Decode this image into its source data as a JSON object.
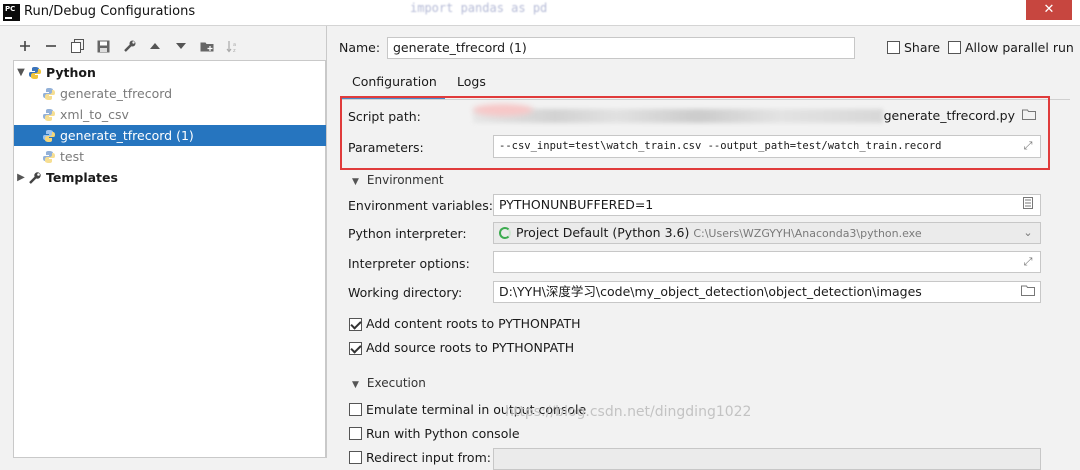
{
  "window": {
    "title": "Run/Debug Configurations",
    "app_icon_text": "PC",
    "background_code": "import pandas as pd",
    "close_glyph": "✕"
  },
  "toolbar": {
    "icons": [
      "add-icon",
      "remove-icon",
      "copy-icon",
      "save-icon",
      "wrench-icon",
      "move-up-icon",
      "move-down-icon",
      "folder-icon",
      "sort-icon"
    ]
  },
  "tree": {
    "python_label": "Python",
    "items": [
      {
        "label": "generate_tfrecord"
      },
      {
        "label": "xml_to_csv"
      },
      {
        "label": "generate_tfrecord (1)"
      },
      {
        "label": "test"
      }
    ],
    "templates_label": "Templates"
  },
  "form": {
    "name_label": "Name:",
    "name_value": "generate_tfrecord (1)",
    "share_label": "Share",
    "allow_parallel_label": "Allow parallel run",
    "tabs": [
      "Configuration",
      "Logs"
    ],
    "script_path_label": "Script path:",
    "script_path_value": "generate_tfrecord.py",
    "parameters_label": "Parameters:",
    "parameters_value": "--csv_input=test\\watch_train.csv --output_path=test/watch_train.record",
    "environment_section": "Environment",
    "env_vars_label": "Environment variables:",
    "env_vars_value": "PYTHONUNBUFFERED=1",
    "interpreter_label": "Python interpreter:",
    "interpreter_value": "Project Default (Python 3.6)",
    "interpreter_path": "C:\\Users\\WZGYYH\\Anaconda3\\python.exe",
    "interpreter_options_label": "Interpreter options:",
    "interpreter_options_value": "",
    "working_dir_label": "Working directory:",
    "working_dir_value": "D:\\YYH\\深度学习\\code\\my_object_detection\\object_detection\\images",
    "add_content_roots_label": "Add content roots to PYTHONPATH",
    "add_source_roots_label": "Add source roots to PYTHONPATH",
    "execution_section": "Execution",
    "emulate_terminal_label": "Emulate terminal in output console",
    "run_with_console_label": "Run with Python console",
    "redirect_input_label": "Redirect input from:"
  },
  "watermark": "https://blog.csdn.net/dingding1022",
  "colors": {
    "selection": "#2675bf",
    "highlight_box": "#e03b3b",
    "tab_underline": "#4a88c7",
    "close_button": "#c7463f"
  }
}
